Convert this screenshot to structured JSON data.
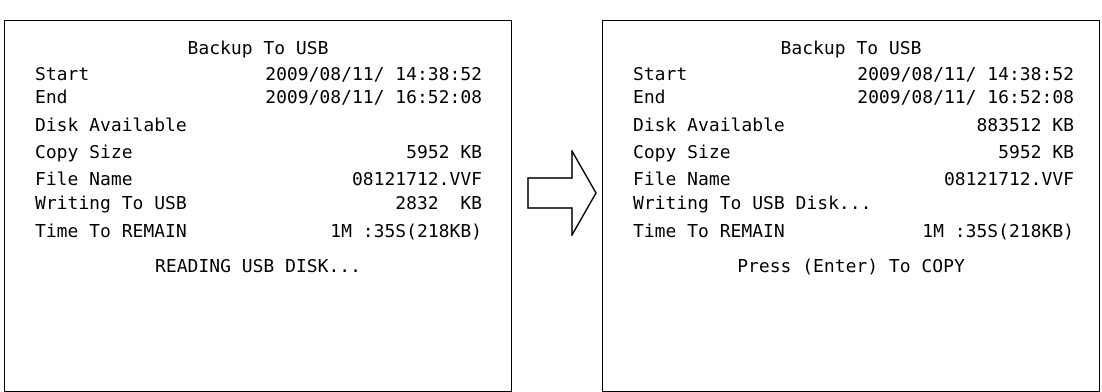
{
  "left_panel": {
    "title": "Backup To USB",
    "rows": [
      {
        "label": "Start",
        "value": "2009/08/11/ 14:38:52"
      },
      {
        "label": "End",
        "value": "2009/08/11/ 16:52:08"
      },
      {
        "label": "Disk Available",
        "value": ""
      },
      {
        "label": "Copy Size",
        "value": "5952 KB"
      },
      {
        "label": "File Name",
        "value": "08121712.VVF"
      },
      {
        "label": "Writing To USB",
        "value": "2832  KB"
      },
      {
        "label": "Time To REMAIN",
        "value": "1M :35S(218KB)"
      }
    ],
    "message": "READING USB DISK..."
  },
  "right_panel": {
    "title": "Backup To USB",
    "rows": [
      {
        "label": "Start",
        "value": "2009/08/11/ 14:38:52"
      },
      {
        "label": "End",
        "value": "2009/08/11/ 16:52:08"
      },
      {
        "label": "Disk Available",
        "value": "883512 KB"
      },
      {
        "label": "Copy Size",
        "value": "5952 KB"
      },
      {
        "label": "File Name",
        "value": "08121712.VVF"
      },
      {
        "label": "Writing To USB Disk...",
        "value": ""
      },
      {
        "label": "Time To REMAIN",
        "value": "1M :35S(218KB)"
      }
    ],
    "message": "Press (Enter) To COPY"
  },
  "arrow": {
    "icon": "right-arrow-icon"
  }
}
